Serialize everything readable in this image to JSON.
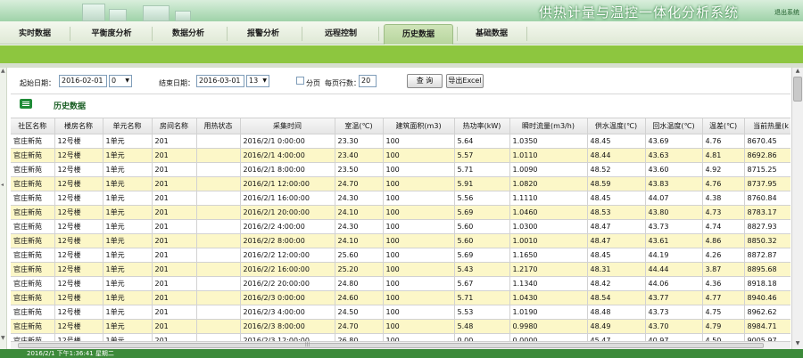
{
  "app": {
    "title": "供热计量与温控一体化分析系统",
    "logout": "退出系统"
  },
  "nav": {
    "tabs": [
      {
        "label": "实时数据"
      },
      {
        "label": "平衡度分析"
      },
      {
        "label": "数据分析"
      },
      {
        "label": "报警分析"
      },
      {
        "label": "远程控制"
      },
      {
        "label": "历史数据"
      },
      {
        "label": "基础数据"
      }
    ],
    "active": "历史数据"
  },
  "filter": {
    "start_label": "起始日期：",
    "start_date": "2016-02-01",
    "start_hour": "0",
    "end_label": "结束日期：",
    "end_date": "2016-03-01",
    "end_hour": "13",
    "paging_label": "分页",
    "rows_per_page_label": "每页行数：",
    "rows_per_page": "20",
    "query_button": "查 询",
    "export_button": "导出Excel"
  },
  "section": {
    "title": "历史数据",
    "icon": "list-icon"
  },
  "table": {
    "columns": [
      "社区名称",
      "楼房名称",
      "单元名称",
      "房间名称",
      "用热状态",
      "采集时间",
      "室温(℃)",
      "建筑面积(m3)",
      "热功率(kW)",
      "瞬时流量(m3/h)",
      "供水温度(℃)",
      "回水温度(℃)",
      "温差(℃)",
      "当前热量(k"
    ],
    "rows": [
      [
        "官庄新苑",
        "12号楼",
        "1单元",
        "201",
        "",
        "2016/2/1 0:00:00",
        "23.30",
        "100",
        "5.64",
        "1.0350",
        "48.45",
        "43.69",
        "4.76",
        "8670.45"
      ],
      [
        "官庄新苑",
        "12号楼",
        "1单元",
        "201",
        "",
        "2016/2/1 4:00:00",
        "23.40",
        "100",
        "5.57",
        "1.0110",
        "48.44",
        "43.63",
        "4.81",
        "8692.86"
      ],
      [
        "官庄新苑",
        "12号楼",
        "1单元",
        "201",
        "",
        "2016/2/1 8:00:00",
        "23.50",
        "100",
        "5.71",
        "1.0090",
        "48.52",
        "43.60",
        "4.92",
        "8715.25"
      ],
      [
        "官庄新苑",
        "12号楼",
        "1单元",
        "201",
        "",
        "2016/2/1 12:00:00",
        "24.70",
        "100",
        "5.91",
        "1.0820",
        "48.59",
        "43.83",
        "4.76",
        "8737.95"
      ],
      [
        "官庄新苑",
        "12号楼",
        "1单元",
        "201",
        "",
        "2016/2/1 16:00:00",
        "24.30",
        "100",
        "5.56",
        "1.1110",
        "48.45",
        "44.07",
        "4.38",
        "8760.84"
      ],
      [
        "官庄新苑",
        "12号楼",
        "1单元",
        "201",
        "",
        "2016/2/1 20:00:00",
        "24.10",
        "100",
        "5.69",
        "1.0460",
        "48.53",
        "43.80",
        "4.73",
        "8783.17"
      ],
      [
        "官庄新苑",
        "12号楼",
        "1单元",
        "201",
        "",
        "2016/2/2 4:00:00",
        "24.30",
        "100",
        "5.60",
        "1.0300",
        "48.47",
        "43.73",
        "4.74",
        "8827.93"
      ],
      [
        "官庄新苑",
        "12号楼",
        "1单元",
        "201",
        "",
        "2016/2/2 8:00:00",
        "24.10",
        "100",
        "5.60",
        "1.0010",
        "48.47",
        "43.61",
        "4.86",
        "8850.32"
      ],
      [
        "官庄新苑",
        "12号楼",
        "1单元",
        "201",
        "",
        "2016/2/2 12:00:00",
        "25.60",
        "100",
        "5.69",
        "1.1650",
        "48.45",
        "44.19",
        "4.26",
        "8872.87"
      ],
      [
        "官庄新苑",
        "12号楼",
        "1单元",
        "201",
        "",
        "2016/2/2 16:00:00",
        "25.20",
        "100",
        "5.43",
        "1.2170",
        "48.31",
        "44.44",
        "3.87",
        "8895.68"
      ],
      [
        "官庄新苑",
        "12号楼",
        "1单元",
        "201",
        "",
        "2016/2/2 20:00:00",
        "24.80",
        "100",
        "5.67",
        "1.1340",
        "48.42",
        "44.06",
        "4.36",
        "8918.18"
      ],
      [
        "官庄新苑",
        "12号楼",
        "1单元",
        "201",
        "",
        "2016/2/3 0:00:00",
        "24.60",
        "100",
        "5.71",
        "1.0430",
        "48.54",
        "43.77",
        "4.77",
        "8940.46"
      ],
      [
        "官庄新苑",
        "12号楼",
        "1单元",
        "201",
        "",
        "2016/2/3 4:00:00",
        "24.50",
        "100",
        "5.53",
        "1.0190",
        "48.48",
        "43.73",
        "4.75",
        "8962.62"
      ],
      [
        "官庄新苑",
        "12号楼",
        "1单元",
        "201",
        "",
        "2016/2/3 8:00:00",
        "24.70",
        "100",
        "5.48",
        "0.9980",
        "48.49",
        "43.70",
        "4.79",
        "8984.71"
      ],
      [
        "官庄新苑",
        "12号楼",
        "1单元",
        "201",
        "",
        "2016/2/3 12:00:00",
        "26.80",
        "100",
        "0.00",
        "0.0000",
        "45.47",
        "40.97",
        "4.50",
        "9005.97"
      ]
    ]
  },
  "status": {
    "text": "2016/2/1 下午1:36:41 星期二"
  }
}
